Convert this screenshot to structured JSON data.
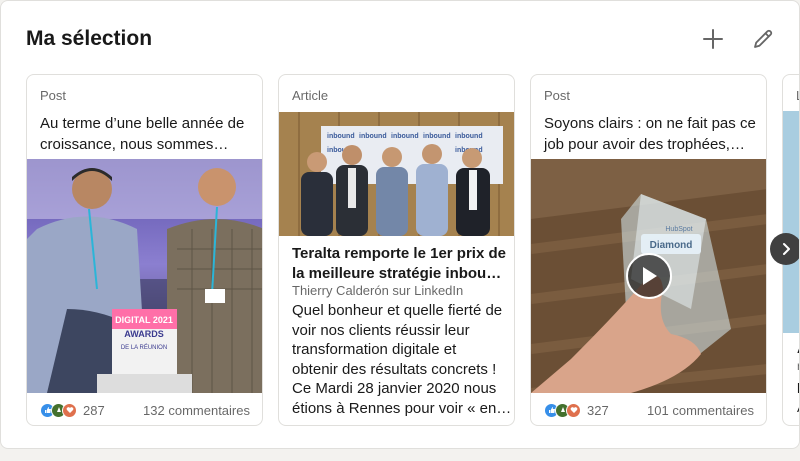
{
  "section": {
    "title": "Ma sélection"
  },
  "header_actions": {
    "add_icon": "plus-icon",
    "edit_icon": "pencil-icon"
  },
  "cards": [
    {
      "type": "Post",
      "excerpt_lines": [
        "Au terme d’une belle année de",
        "croissance, nous sommes…"
      ],
      "reactions_count": "287",
      "comments": "132 commentaires",
      "media_text": [
        "DIGITAL 2021",
        "AWARDS",
        "DE LA RÉUNION"
      ]
    },
    {
      "type": "Article",
      "title_lines": [
        "Teralta remporte le 1er prix de",
        "la meilleure stratégie inboun…"
      ],
      "author": "Thierry Calderón sur LinkedIn",
      "body_lines": [
        "Quel bonheur et quelle fierté de",
        "voir nos clients réussir leur",
        "transformation digitale et",
        "obtenir des résultats concrets !",
        "Ce Mardi 28 janvier 2020 nous",
        "étions à Rennes pour voir « en…"
      ],
      "banner_word": "inbound"
    },
    {
      "type": "Post",
      "excerpt_lines": [
        "Soyons clairs : on ne fait pas ce",
        "job pour avoir des trophées,…"
      ],
      "reactions_count": "327",
      "comments": "101 commentaires",
      "media_text": [
        "HubSpot",
        "Diamond"
      ]
    },
    {
      "type": "L",
      "peek_letters": [
        "A",
        "r",
        "k",
        "A",
        "L",
        "k"
      ]
    }
  ],
  "colors": {
    "like": "#378fe9",
    "celebrate": "#44712e",
    "love": "#df704d",
    "next_button": "#404040"
  },
  "next_icon": "chevron-right-icon"
}
